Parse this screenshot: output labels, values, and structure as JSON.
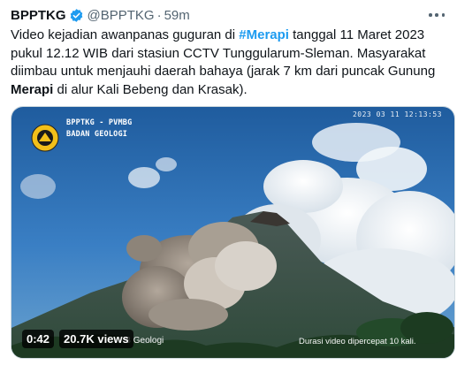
{
  "tweet": {
    "display_name": "BPPTKG",
    "handle": "@BPPTKG",
    "separator": "·",
    "time": "59m",
    "text": {
      "line1_a": "Video kejadian awanpanas guguran di ",
      "hashtag": "#Merapi",
      "line1_b": " tanggal 11 Maret 2023",
      "line2": "pukul 12.12 WIB dari stasiun CCTV Tunggularum-Sleman. Masyarakat",
      "line3": "diimbau untuk menjauhi daerah bahaya (jarak 7 km dari puncak Gunung",
      "line4_bold": "Merapi",
      "line4_rest": " di alur Kali Bebeng dan Krasak)."
    }
  },
  "video": {
    "org_line1": "BPPTKG - PVMBG",
    "org_line2": "BADAN GEOLOGI",
    "timestamp": "2023 03 11 12:13:53",
    "credit": "-B Geologi",
    "note": "Durasi video dipercepat 10 kali.",
    "duration": "0:42",
    "views": "20.7K views"
  },
  "icons": {
    "verified": "verified-badge-icon",
    "more": "more-options-icon",
    "logo": "badan-geologi-logo"
  },
  "colors": {
    "accent": "#1d9bf0",
    "sky": "#2f6fb3",
    "text": "#0f1419",
    "muted": "#536471"
  }
}
